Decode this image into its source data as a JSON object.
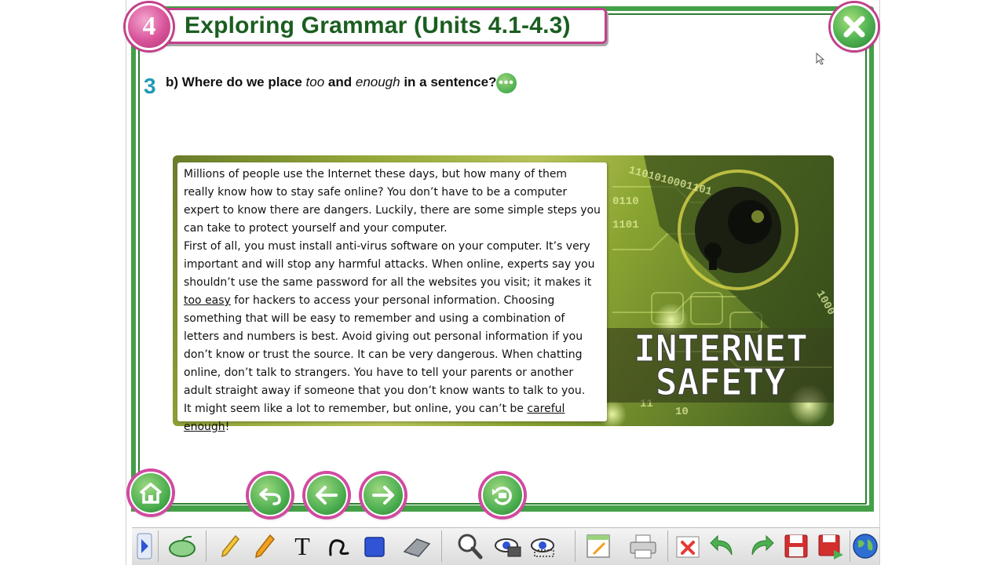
{
  "header": {
    "unit_number": "4",
    "title": "Exploring Grammar (Units 4.1-4.3)"
  },
  "exercise": {
    "number": "3",
    "question_parts": [
      "b) Where do we place ",
      "too",
      " and ",
      "enough",
      " in a sentence?"
    ]
  },
  "reading": {
    "paragraphs": [
      {
        "text": "Millions of people use the Internet these days, but how many of them really know how to stay safe online? You don’t have to be a computer expert to know there are dangers. Luckily, there are some simple steps you can take to protect yourself and your computer."
      },
      {
        "before": "First of all, you must install anti-virus software on your computer. It’s very important and will stop any harmful attacks. When online, experts say you shouldn’t use the same password for all the websites you visit; it makes it ",
        "underlined": "too easy",
        "after": " for hackers to access your personal information. Choosing something that will be easy to remember and using a combination of letters and numbers is best. Avoid giving out personal information if you don’t know or trust the source. It can be very dangerous. When chatting online, don’t talk to strangers. You have to tell your parents or another adult straight away if someone that you don’t know wants to talk to you."
      },
      {
        "before": "It might seem like a lot to remember, but online, you can’t be ",
        "underlined": "careful enough",
        "after": "!"
      }
    ]
  },
  "picture": {
    "caption_line1": "INTERNET",
    "caption_line2": "SAFETY",
    "binary_a": "1101010001101",
    "binary_b": "0110",
    "binary_c": "1101",
    "binary_d": "1000",
    "binary_e": "11",
    "binary_f": "10"
  },
  "navigation": [
    "home-icon",
    "undo-icon",
    "previous-icon",
    "next-icon",
    "replay-icon"
  ],
  "toolbar": {
    "tools": [
      "expand-icon",
      "mouse-icon",
      "highlighter-icon",
      "pencil-icon",
      "text-icon",
      "curve-icon",
      "shape-icon",
      "eraser-icon",
      "zoom-icon",
      "spotlight-icon",
      "hide-icon",
      "notes-icon",
      "print-icon",
      "clear-icon",
      "undo-icon",
      "redo-icon",
      "save-icon",
      "save-as-icon",
      "globe-icon"
    ],
    "text_tool_glyph": "T",
    "colors": {
      "pencil": "#f2a01e",
      "shape": "#2f55d4",
      "accent_green": "#43a047",
      "accent_pink": "#c2408b"
    }
  }
}
